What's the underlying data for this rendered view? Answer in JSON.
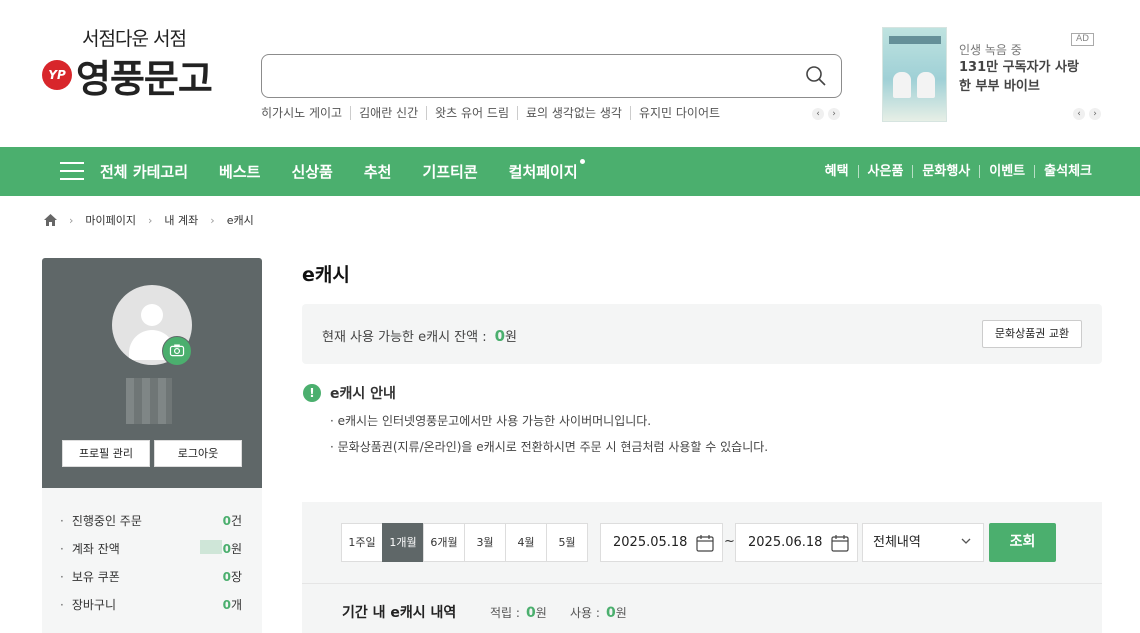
{
  "header": {
    "logo_sub": "서점다운 서점",
    "logo_badge": "YP",
    "logo_main": "영풍문고",
    "search": {
      "value": "",
      "placeholder": ""
    },
    "keywords": [
      "히가시노 게이고",
      "김애란 신간",
      "왓츠 유어 드림",
      "료의 생각없는 생각",
      "유지민 다이어트"
    ],
    "ad": {
      "badge": "AD",
      "subtitle": "인생 녹음 중",
      "title": "131만 구독자가 사랑한 부부 바이브"
    },
    "arrow_prev": "‹",
    "arrow_next": "›"
  },
  "nav": {
    "main_items": [
      "전체 카테고리",
      "베스트",
      "신상품",
      "추천",
      "기프티콘",
      "컬처페이지"
    ],
    "sub_items": [
      "혜택",
      "사은품",
      "문화행사",
      "이벤트",
      "출석체크"
    ]
  },
  "breadcrumb": [
    "마이페이지",
    "내 계좌",
    "e캐시"
  ],
  "sidebar": {
    "profile_button": "프로필 관리",
    "logout_button": "로그아웃",
    "stats": [
      {
        "label": "진행중인 주문",
        "value": "0",
        "unit": "건"
      },
      {
        "label": "계좌 잔액",
        "value": "0",
        "unit": "원"
      },
      {
        "label": "보유 쿠폰",
        "value": "0",
        "unit": "장"
      },
      {
        "label": "장바구니",
        "value": "0",
        "unit": "개"
      }
    ]
  },
  "main": {
    "title": "e캐시",
    "balance_label": "현재 사용 가능한 e캐시 잔액 :",
    "balance_value": "0",
    "balance_unit": "원",
    "exchange_button": "문화상품권 교환",
    "info_title": "e캐시 안내",
    "info_lines": [
      "· e캐시는 인터넷영풍문고에서만 사용 가능한 사이버머니입니다.",
      "· 문화상품권(지류/온라인)을 e캐시로 전환하시면 주문 시 현금처럼 사용할 수 있습니다."
    ],
    "periods": [
      "1주일",
      "1개월",
      "6개월",
      "3월",
      "4월",
      "5월"
    ],
    "active_period": "1개월",
    "date_from": "2025.05.18",
    "date_to": "2025.06.18",
    "tilde": "~",
    "type_select": "전체내역",
    "search_button": "조회",
    "summary_title": "기간 내 e캐시 내역",
    "earn_label": "적립 :",
    "earn_value": "0",
    "use_label": "사용 :",
    "use_value": "0",
    "won": "원"
  },
  "colors": {
    "brand_green": "#4baf6e",
    "sidebar_gray": "#5f6768",
    "logo_red": "#d8262b"
  }
}
